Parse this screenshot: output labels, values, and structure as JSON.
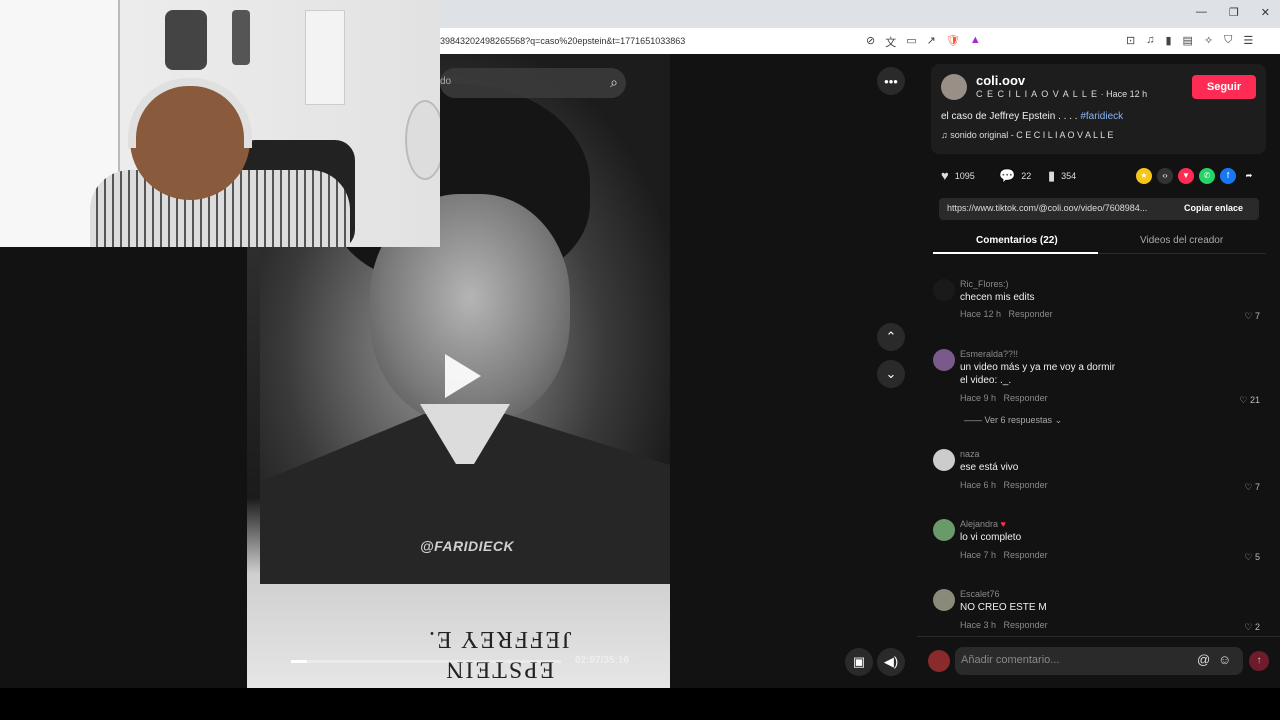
{
  "browser": {
    "url": "39843202498265568?q=caso%20epstein&t=1771651033863",
    "window_controls": [
      "—",
      "❐",
      "✕"
    ],
    "toolbar_icons": [
      "⊘",
      "文",
      "▭",
      "↗",
      "🛡",
      "▲"
    ],
    "right_icons": [
      "⊡",
      "♫",
      "▮",
      "▤",
      "✧",
      "⛉",
      "☰"
    ]
  },
  "search": {
    "placeholder": "do",
    "icon": "search-icon"
  },
  "video": {
    "watermark": "@FARIDIECK",
    "caption_line1": "JEFFREY E.",
    "caption_line2": "EPSTEIN",
    "time": "02:07/35:16",
    "progress_fraction": 0.06,
    "play_icon": "play-icon"
  },
  "creator": {
    "handle": "coli.oov",
    "display_name": "C E C I L I A O V A L L E",
    "time_ago": "· Hace 12 h",
    "follow_label": "Seguir",
    "description": "el caso de Jeffrey Epstein . . . .",
    "hashtag": "#faridieck",
    "sound": "sonido original - C E C I L I A O V A L L E"
  },
  "stats": {
    "likes": "1095",
    "comments": "22",
    "saves": "354"
  },
  "link": {
    "url": "https://www.tiktok.com/@coli.oov/video/7608984...",
    "copy_label": "Copiar enlace"
  },
  "tabs": {
    "comments": "Comentarios (22)",
    "creator_videos": "Videos del creador"
  },
  "comments": [
    {
      "user": "Ric_Flores:)",
      "text": "checen mis edits",
      "time": "Hace 12 h",
      "reply": "Responder",
      "likes": "7"
    },
    {
      "user": "Esmeralda??!!",
      "text": "un video más y ya me voy a dormir",
      "text2": "el video: ._.",
      "time": "Hace 9 h",
      "reply": "Responder",
      "likes": "21",
      "replies": "Ver 6 respuestas"
    },
    {
      "user": "naza",
      "text": "ese está vivo",
      "time": "Hace 6 h",
      "reply": "Responder",
      "likes": "7"
    },
    {
      "user": "Alejandra",
      "text": "lo vi completo",
      "time": "Hace 7 h",
      "reply": "Responder",
      "likes": "5"
    },
    {
      "user": "Escalet76",
      "text": "NO CREO ESTE M",
      "time": "Hace 3 h",
      "reply": "Responder",
      "likes": "2"
    }
  ],
  "comment_input": {
    "placeholder": "Añadir comentario..."
  },
  "colors": {
    "accent": "#fe2c55",
    "hashtag": "#8ab4f8",
    "background": "#121212"
  }
}
